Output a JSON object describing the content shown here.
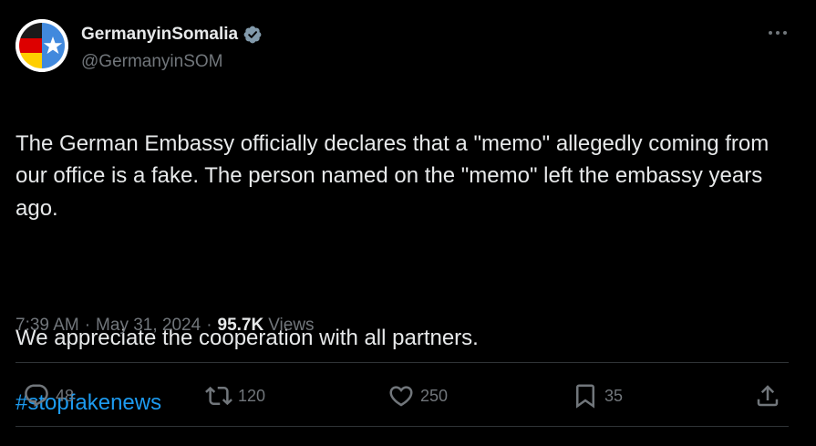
{
  "tweet": {
    "author": {
      "display_name": "GermanyinSomalia",
      "handle": "@GermanyinSOM",
      "verified": true,
      "verified_color": "#829aab"
    },
    "more_icon": "more-horizontal-icon",
    "text_paragraph_1": "The German Embassy officially declares that a \"memo\" allegedly coming from our office is a fake. The person named on the \"memo\" left the embassy years ago.",
    "text_paragraph_2": "We appreciate the cooperation with all partners.",
    "hashtag": "#stopfakenews",
    "time": "7:39 AM",
    "separator": "·",
    "date": "May 31, 2024",
    "views_count": "95.7K",
    "views_label": "Views"
  },
  "actions": {
    "reply": {
      "icon": "reply-icon",
      "count": "48"
    },
    "retweet": {
      "icon": "retweet-icon",
      "count": "120"
    },
    "like": {
      "icon": "heart-icon",
      "count": "250"
    },
    "bookmark": {
      "icon": "bookmark-icon",
      "count": "35"
    },
    "share": {
      "icon": "share-icon"
    }
  },
  "colors": {
    "background": "#000000",
    "text_primary": "#e7e9ea",
    "text_secondary": "#71767b",
    "link": "#1d9bf0",
    "divider": "#2f3336",
    "flag_black": "#1a1a1a",
    "flag_red": "#dd0000",
    "flag_gold": "#ffce00",
    "flag_blue": "#4189dd"
  }
}
